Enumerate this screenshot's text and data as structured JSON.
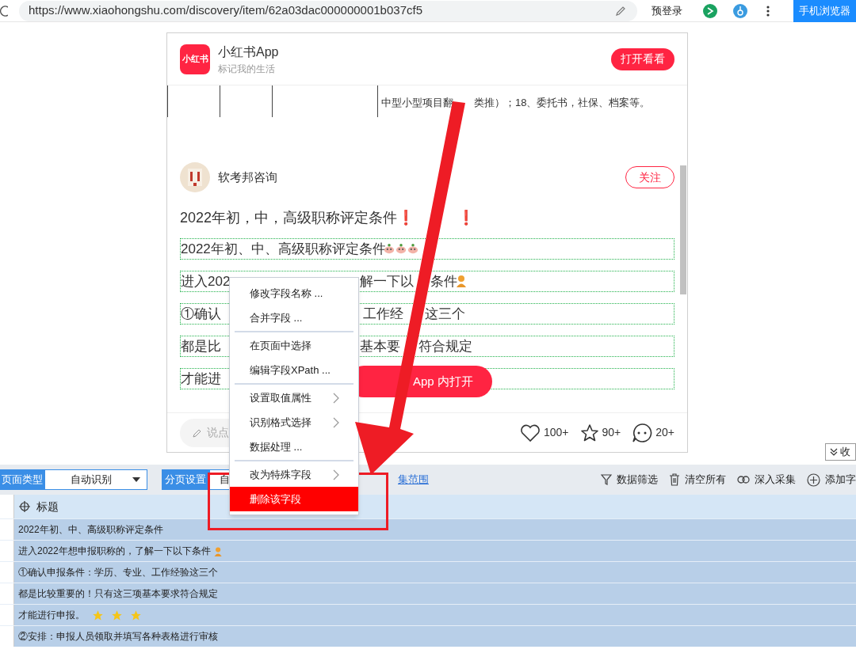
{
  "browser": {
    "url": "https://www.xiaohongshu.com/discovery/item/62a03dac000000001b037cf5",
    "login": "预登录",
    "mobile_button": "手机浏览器"
  },
  "app_banner": {
    "logo": "小红书",
    "name": "小红书App",
    "slogan": "标记我的生活",
    "open_button": "打开看看"
  },
  "image_text": [
    "中型小型项目翻",
    "类推）；18、委托书，社保、档案等。"
  ],
  "author": {
    "name": "软考邦咨询",
    "follow": "关注"
  },
  "title": [
    "2022年初，中，高级职称评定条件❗",
    "❗"
  ],
  "lines": [
    {
      "segments": [
        "2022年初、中、高级职称评定条件"
      ]
    },
    {
      "segments": [
        "进入202",
        "解一下以",
        "条件"
      ]
    },
    {
      "segments": [
        "①确认",
        "工作经",
        "这三个"
      ]
    },
    {
      "segments": [
        "都是比",
        "基本要",
        "符合规定"
      ]
    },
    {
      "segments": [
        "才能进"
      ]
    }
  ],
  "open_in_app": "App 内打开",
  "footer": {
    "comment_placeholder": "说点",
    "likes": "100+",
    "favorites": "90+",
    "comments": "20+"
  },
  "context_menu": {
    "groups": [
      {
        "items": [
          {
            "label": "修改字段名称 ...",
            "kind": "item",
            "selected": false
          },
          {
            "label": "合并字段 ...",
            "kind": "item",
            "selected": false
          }
        ]
      },
      {
        "items": [
          {
            "label": "在页面中选择",
            "kind": "item",
            "selected": false
          },
          {
            "label": "编辑字段XPath ...",
            "kind": "item",
            "selected": false
          }
        ]
      },
      {
        "items": [
          {
            "label": "设置取值属性",
            "kind": "submenu",
            "selected": false
          },
          {
            "label": "识别格式选择",
            "kind": "submenu",
            "selected": false
          },
          {
            "label": "数据处理 ...",
            "kind": "item",
            "selected": false
          }
        ]
      },
      {
        "items": [
          {
            "label": "改为特殊字段",
            "kind": "submenu",
            "selected": false
          },
          {
            "label": "删除该字段",
            "kind": "item",
            "selected": true
          }
        ]
      }
    ]
  },
  "collapse_button": "收",
  "toolbar": {
    "page_type_label": "页面类型",
    "page_type": "自动识别",
    "paging_label": "分页设置",
    "paging_value": "自",
    "range_link": "集范围",
    "actions": [
      "数据筛选",
      "清空所有",
      "深入采集",
      "添加字"
    ]
  },
  "table": {
    "column": "标题",
    "rows": [
      "2022年初、中、高级职称评定条件",
      "进入2022年想申报职称的，了解一下以下条件",
      "①确认申报条件：学历、专业、工作经验这三个",
      "都是比较重要的！只有这三项基本要求符合规定",
      "才能进行申报。",
      "②安排：申报人员领取并填写各种表格进行审核"
    ]
  }
}
